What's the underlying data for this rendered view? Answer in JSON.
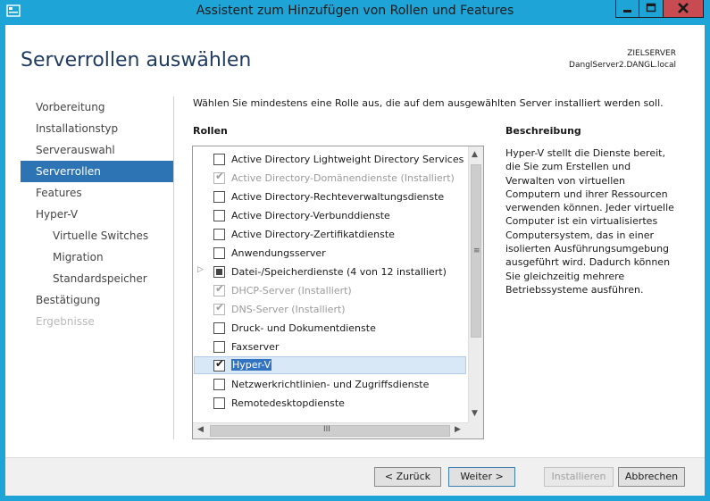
{
  "window": {
    "title": "Assistent zum Hinzufügen von Rollen und Features"
  },
  "page": {
    "title": "Serverrollen auswählen",
    "target_label": "ZIELSERVER",
    "target_server": "DanglServer2.DANGL.local"
  },
  "nav": [
    {
      "label": "Vorbereitung",
      "state": "normal",
      "level": 0
    },
    {
      "label": "Installationstyp",
      "state": "normal",
      "level": 0
    },
    {
      "label": "Serverauswahl",
      "state": "normal",
      "level": 0
    },
    {
      "label": "Serverrollen",
      "state": "active",
      "level": 0
    },
    {
      "label": "Features",
      "state": "normal",
      "level": 0
    },
    {
      "label": "Hyper-V",
      "state": "normal",
      "level": 0
    },
    {
      "label": "Virtuelle Switches",
      "state": "normal",
      "level": 1
    },
    {
      "label": "Migration",
      "state": "normal",
      "level": 1
    },
    {
      "label": "Standardspeicher",
      "state": "normal",
      "level": 1
    },
    {
      "label": "Bestätigung",
      "state": "normal",
      "level": 0
    },
    {
      "label": "Ergebnisse",
      "state": "disabled",
      "level": 0
    }
  ],
  "main": {
    "instruction": "Wählen Sie mindestens eine Rolle aus, die auf dem ausgewählten Server installiert werden soll.",
    "roles_heading": "Rollen",
    "description_heading": "Beschreibung",
    "description": "Hyper-V stellt die Dienste bereit, die Sie zum Erstellen und Verwalten von virtuellen Computern und ihrer Ressourcen verwenden können. Jeder virtuelle Computer ist ein virtualisiertes Computersystem, das in einer isolierten Ausführungsumgebung ausgeführt wird. Dadurch können Sie gleichzeitig mehrere Betriebssysteme ausführen."
  },
  "roles": [
    {
      "label": "Active Directory Lightweight Directory Services",
      "state": "unchecked",
      "enabled": true
    },
    {
      "label": "Active Directory-Domänendienste (Installiert)",
      "state": "checked",
      "enabled": false
    },
    {
      "label": "Active Directory-Rechteverwaltungsdienste",
      "state": "unchecked",
      "enabled": true
    },
    {
      "label": "Active Directory-Verbunddienste",
      "state": "unchecked",
      "enabled": true
    },
    {
      "label": "Active Directory-Zertifikatdienste",
      "state": "unchecked",
      "enabled": true
    },
    {
      "label": "Anwendungsserver",
      "state": "unchecked",
      "enabled": true
    },
    {
      "label": "Datei-/Speicherdienste (4 von 12 installiert)",
      "state": "partial",
      "enabled": true,
      "expandable": true
    },
    {
      "label": "DHCP-Server (Installiert)",
      "state": "checked",
      "enabled": false
    },
    {
      "label": "DNS-Server (Installiert)",
      "state": "checked",
      "enabled": false
    },
    {
      "label": "Druck- und Dokumentdienste",
      "state": "unchecked",
      "enabled": true
    },
    {
      "label": "Faxserver",
      "state": "unchecked",
      "enabled": true
    },
    {
      "label": "Hyper-V",
      "state": "checked",
      "enabled": true,
      "selected": true
    },
    {
      "label": "Netzwerkrichtlinien- und Zugriffsdienste",
      "state": "unchecked",
      "enabled": true
    },
    {
      "label": "Remotedesktopdienste",
      "state": "unchecked",
      "enabled": true
    }
  ],
  "scroll": {
    "horizontal_grip": "III",
    "vertical_grip": "≡"
  },
  "buttons": {
    "back": "< Zurück",
    "next": "Weiter >",
    "install": "Installieren",
    "cancel": "Abbrechen"
  },
  "colors": {
    "titlebar": "#1ea4d6",
    "nav_active": "#2d74b4",
    "close_button": "#c74b50"
  }
}
